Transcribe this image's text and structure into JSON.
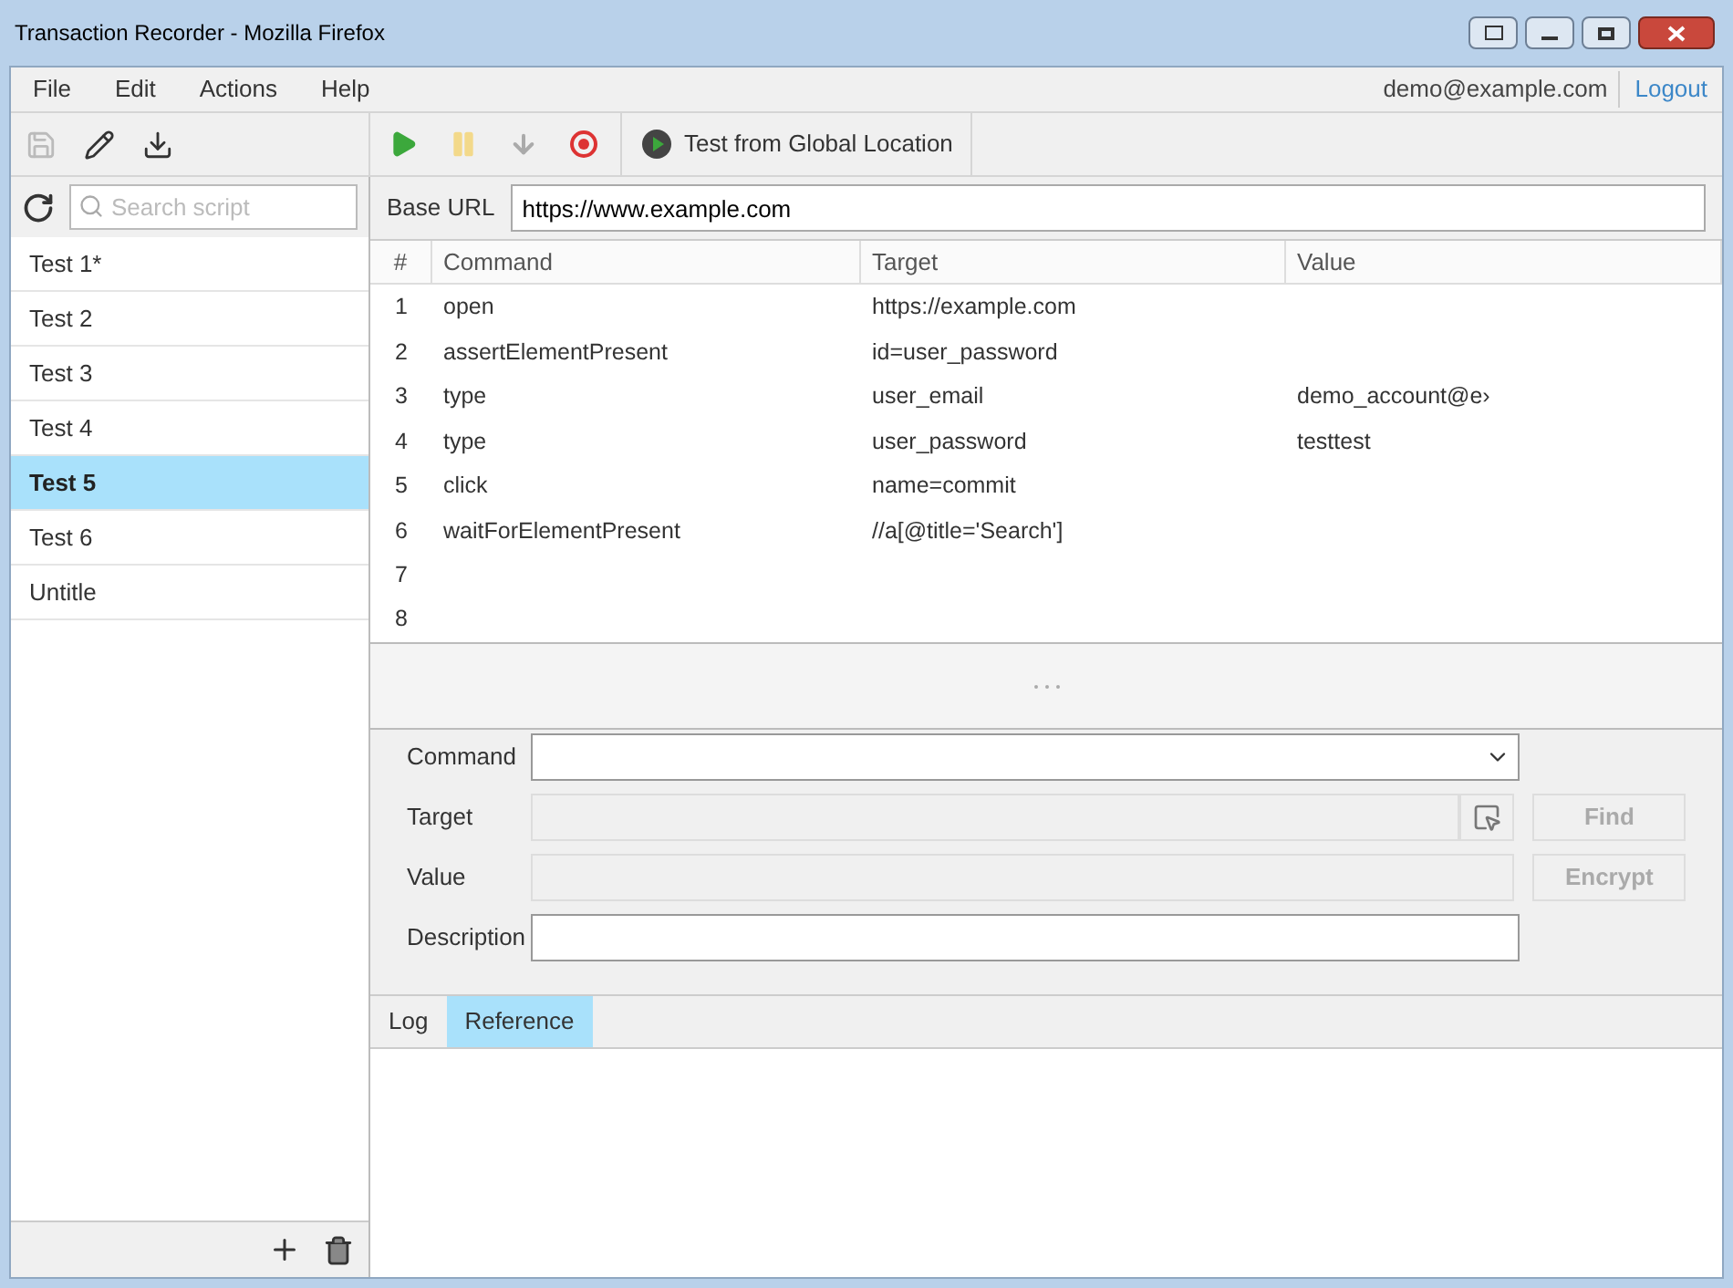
{
  "window": {
    "title": "Transaction Recorder - Mozilla Firefox"
  },
  "menu": [
    "File",
    "Edit",
    "Actions",
    "Help"
  ],
  "account": {
    "email": "demo@example.com",
    "logout": "Logout"
  },
  "toolbar": {
    "global_test": "Test from Global Location",
    "save_disabled": true,
    "pause_disabled": true,
    "step_disabled": true
  },
  "search": {
    "placeholder": "Search script"
  },
  "scripts": [
    {
      "label": "Test 1*",
      "selected": false
    },
    {
      "label": "Test 2",
      "selected": false
    },
    {
      "label": "Test 3",
      "selected": false
    },
    {
      "label": "Test 4",
      "selected": false
    },
    {
      "label": "Test 5",
      "selected": true
    },
    {
      "label": "Test 6",
      "selected": false
    },
    {
      "label": "Untitle",
      "selected": false
    }
  ],
  "base_url": {
    "label": "Base URL",
    "value": "https://www.example.com"
  },
  "table": {
    "columns": [
      "#",
      "Command",
      "Target",
      "Value"
    ],
    "rows": [
      [
        "1",
        "open",
        "https://example.com",
        ""
      ],
      [
        "2",
        "assertElementPresent",
        "id=user_password",
        ""
      ],
      [
        "3",
        "type",
        "user_email",
        "demo_account@e›"
      ],
      [
        "4",
        "type",
        "user_password",
        "testtest"
      ],
      [
        "5",
        "click",
        "name=commit",
        ""
      ],
      [
        "6",
        "waitForElementPresent",
        "//a[@title='Search']",
        ""
      ],
      [
        "7",
        "",
        "",
        ""
      ],
      [
        "8",
        "",
        "",
        ""
      ]
    ]
  },
  "form": {
    "command_label": "Command",
    "target_label": "Target",
    "value_label": "Value",
    "description_label": "Description",
    "find": "Find",
    "encrypt": "Encrypt",
    "target_disabled": true,
    "value_disabled": true
  },
  "bottom_tabs": [
    {
      "label": "Log",
      "selected": false
    },
    {
      "label": "Reference",
      "selected": true
    }
  ]
}
